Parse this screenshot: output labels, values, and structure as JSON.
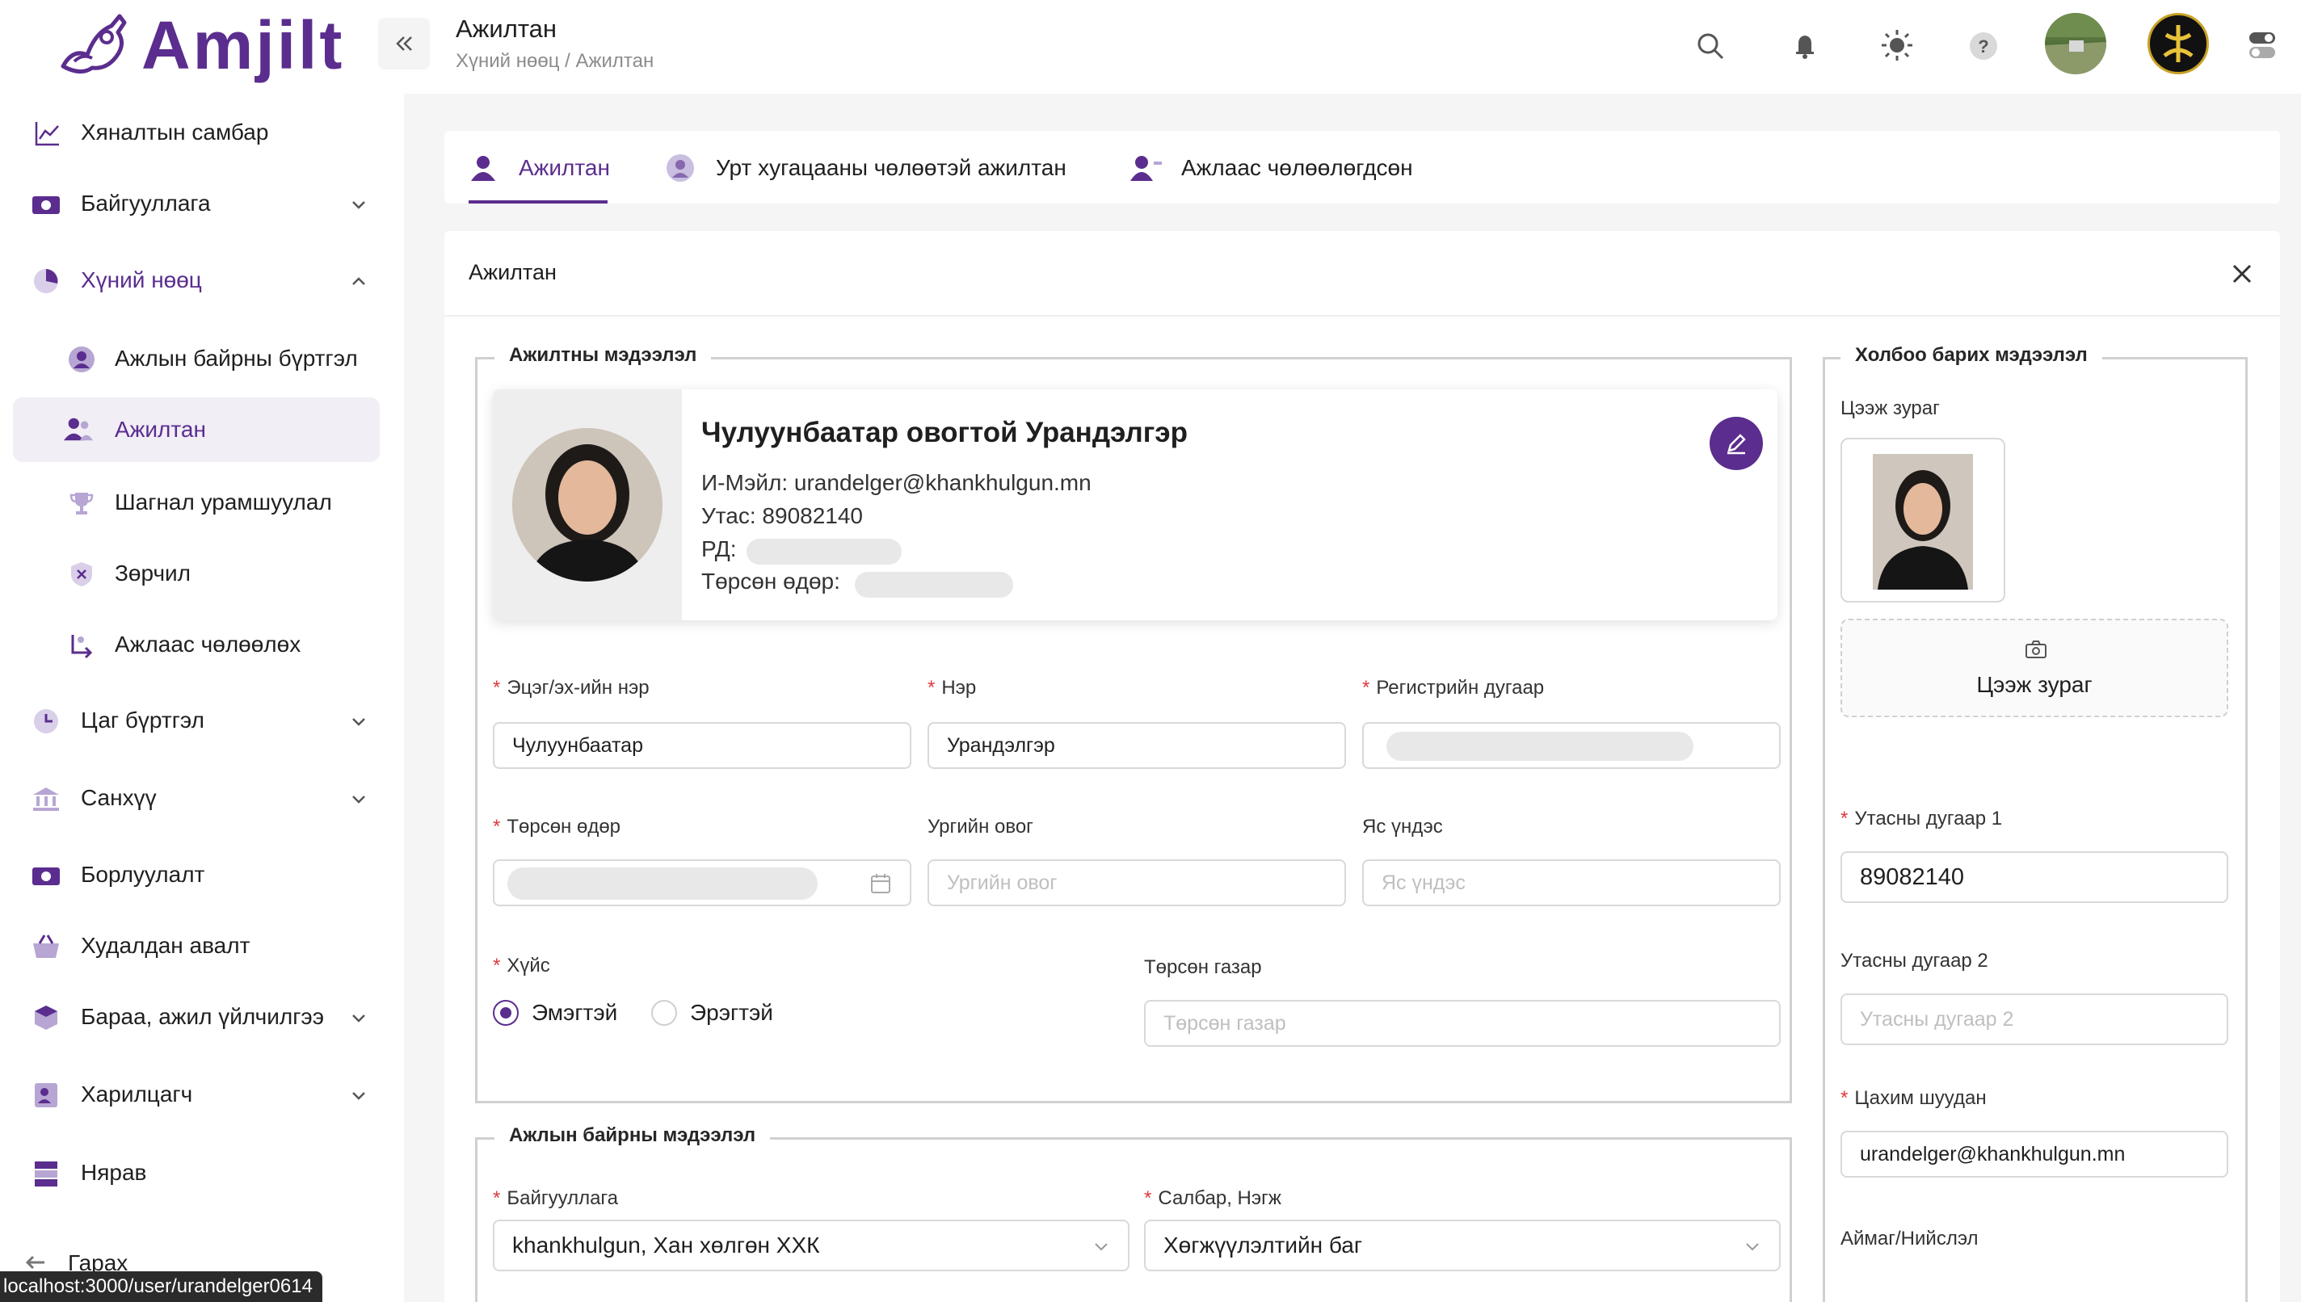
{
  "brand": {
    "name": "Amjilt",
    "color": "#5b2d8e"
  },
  "header": {
    "title": "Ажилтан",
    "breadcrumb": "Хүний нөөц / Ажилтан"
  },
  "sidebar": {
    "items": [
      {
        "label": "Хяналтын самбар",
        "icon": "chart-line-icon"
      },
      {
        "label": "Байгууллага",
        "icon": "building-icon"
      },
      {
        "label": "Хүний нөөц",
        "icon": "pie-chart-icon"
      },
      {
        "label": "Ажлын байрны бүртгэл",
        "icon": "user-circle-icon"
      },
      {
        "label": "Ажилтан",
        "icon": "users-icon"
      },
      {
        "label": "Шагнал урамшуулал",
        "icon": "trophy-icon"
      },
      {
        "label": "Зөрчил",
        "icon": "shield-x-icon"
      },
      {
        "label": "Ажлаас чөлөөлөх",
        "icon": "user-leave-icon"
      },
      {
        "label": "Цаг бүртгэл",
        "icon": "clock-icon"
      },
      {
        "label": "Санхүү",
        "icon": "bank-icon"
      },
      {
        "label": "Борлуулалт",
        "icon": "cash-icon"
      },
      {
        "label": "Худалдан авалт",
        "icon": "basket-icon"
      },
      {
        "label": "Бараа, ажил үйлчилгээ",
        "icon": "box-icon"
      },
      {
        "label": "Харилцагч",
        "icon": "contact-icon"
      },
      {
        "label": "Нярав",
        "icon": "storage-icon"
      },
      {
        "label": "Гарах",
        "icon": "logout-icon"
      }
    ]
  },
  "status_url": "localhost:3000/user/urandelger0614",
  "tabs": [
    {
      "label": "Ажилтан",
      "active": true
    },
    {
      "label": "Урт хугацааны чөлөөтэй ажилтан",
      "active": false
    },
    {
      "label": "Ажлаас чөлөөлөгдсөн",
      "active": false
    }
  ],
  "panel": {
    "title": "Ажилтан"
  },
  "employee_info": {
    "legend": "Ажилтны мэдээлэл",
    "full_name": "Чулуунбаатар овогтой Урандэлгэр",
    "email_line": "И-Мэйл: urandelger@khankhulgun.mn",
    "phone_line": "Утас: 89082140",
    "rd_label": "РД:",
    "birth_label": "Төрсөн өдөр:"
  },
  "form": {
    "father_name": {
      "label": "Эцэг/эх-ийн нэр",
      "value": "Чулуунбаатар"
    },
    "first_name": {
      "label": "Нэр",
      "value": "Урандэлгэр"
    },
    "register_no": {
      "label": "Регистрийн дугаар"
    },
    "birth_date": {
      "label": "Төрсөн өдөр"
    },
    "family_name": {
      "label": "Ургийн овог",
      "placeholder": "Ургийн овог"
    },
    "ethnicity": {
      "label": "Яс үндэс",
      "placeholder": "Яс үндэс"
    },
    "gender": {
      "label": "Хүйс",
      "options": [
        "Эмэгтэй",
        "Эрэгтэй"
      ],
      "selected": "Эмэгтэй"
    },
    "birth_place": {
      "label": "Төрсөн газар",
      "placeholder": "Төрсөн газар"
    }
  },
  "job_info": {
    "legend": "Ажлын байрны мэдээлэл",
    "organization": {
      "label": "Байгууллага",
      "value": "khankhulgun, Хан хөлгөн ХХК"
    },
    "department": {
      "label": "Салбар, Нэгж",
      "value": "Хөгжүүлэлтийн баг"
    }
  },
  "contact": {
    "legend": "Холбоо барих мэдээлэл",
    "photo_label": "Цээж зураг",
    "upload_label": "Цээж зураг",
    "phone1": {
      "label": "Утасны дугаар 1",
      "value": "89082140"
    },
    "phone2": {
      "label": "Утасны дугаар 2",
      "placeholder": "Утасны дугаар 2"
    },
    "email": {
      "label": "Цахим шуудан",
      "value": "urandelger@khankhulgun.mn"
    },
    "province": {
      "label": "Аймаг/Нийслэл"
    }
  },
  "colors": {
    "accent": "#5b2d8e",
    "required": "#e0393e",
    "active_bg": "#f1eef6"
  }
}
